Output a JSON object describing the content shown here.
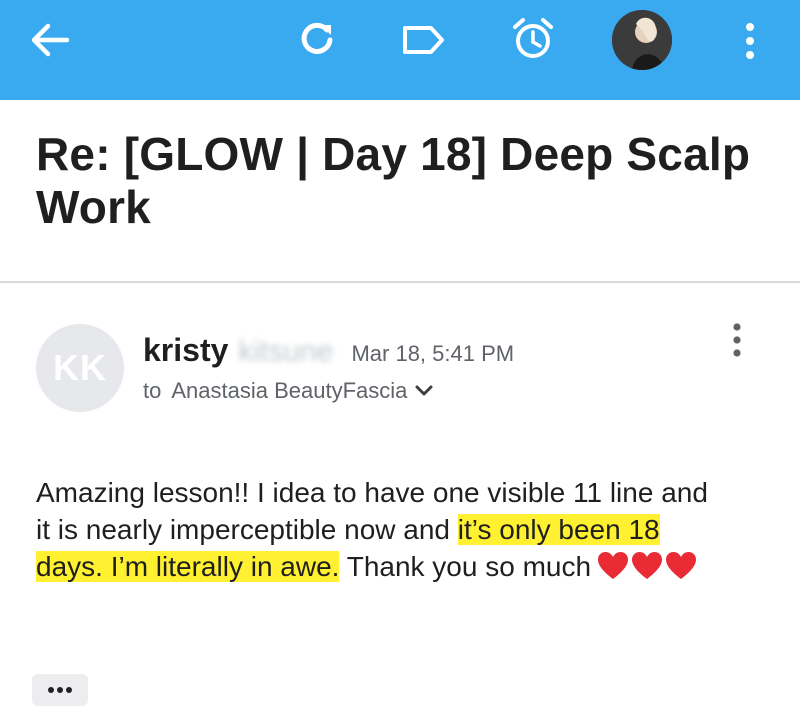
{
  "toolbar": {
    "background": "#3aaaf0",
    "icons": [
      "back-arrow-icon",
      "refresh-icon",
      "label-icon",
      "alarm-clock-icon",
      "account-avatar",
      "more-vert-icon"
    ]
  },
  "email": {
    "subject": "Re: [GLOW | Day 18] Deep Scalp Work",
    "sender": {
      "initials": "KK",
      "first_name": "kristy",
      "last_name_blurred": "kitsune",
      "date": "Mar 18, 5:41 PM"
    },
    "recipient": {
      "prefix": "to",
      "name": "Anastasia BeautyFascia"
    },
    "body": {
      "part1": "Amazing lesson!! I idea to have one visible 11 line and it is nearly imperceptible now and ",
      "highlighted": "it’s only been 18 days. I’m literally in awe.",
      "part2": " Thank you so much",
      "hearts": 3,
      "highlight_color": "#fff131"
    },
    "expand_label": "•••"
  }
}
